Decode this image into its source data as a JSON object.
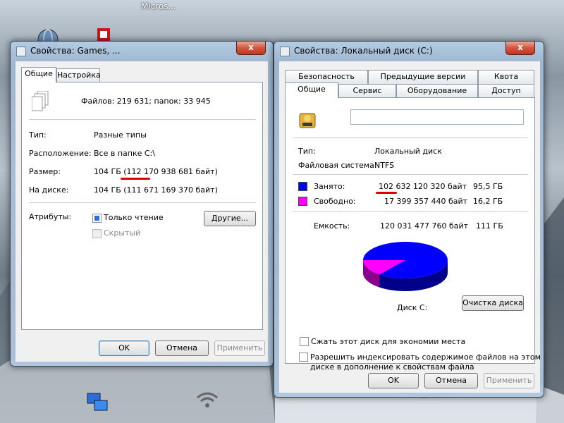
{
  "desktop": {
    "top_label": "Micros..."
  },
  "games_window": {
    "title": "Свойства: Games, ...",
    "close_label": "x",
    "tabs": [
      "Общие",
      "Настройка"
    ],
    "files_summary": "Файлов: 219 631; папок: 33 945",
    "rows": [
      {
        "label": "Тип:",
        "value": "Разные типы"
      },
      {
        "label": "Расположение:",
        "value": "Все в папке C:\\"
      },
      {
        "label": "Размер:",
        "value": "104 ГБ (112 170 938 681 байт)"
      },
      {
        "label": "На диске:",
        "value": "104 ГБ (111 671 169 370 байт)"
      }
    ],
    "attributes_label": "Атрибуты:",
    "readonly_label": "Только чтение",
    "hidden_label": "Скрытый",
    "other_button": "Другие...",
    "ok": "OK",
    "cancel": "Отмена",
    "apply": "Применить"
  },
  "disk_window": {
    "title": "Свойства: Локальный диск (C:)",
    "close_label": "x",
    "tabs_row1": [
      "Безопасность",
      "Предыдущие версии",
      "Квота"
    ],
    "tabs_row2": [
      "Общие",
      "Сервис",
      "Оборудование",
      "Доступ"
    ],
    "type_label": "Тип:",
    "type_value": "Локальный диск",
    "fs_label": "Файловая система:",
    "fs_value": "NTFS",
    "used_label": "Занято:",
    "used_bytes": "102 632 120 320 байт",
    "used_gb": "95,5 ГБ",
    "free_label": "Свободно:",
    "free_bytes": "17 399 357 440 байт",
    "free_gb": "16,2 ГБ",
    "capacity_label": "Емкость:",
    "capacity_bytes": "120 031 477 760 байт",
    "capacity_gb": "111 ГБ",
    "disk_label": "Диск C:",
    "cleanup_button": "Очистка диска",
    "compress_label": "Сжать этот диск для экономии места",
    "index_label_1": "Разрешить индексировать содержимое файлов на этом",
    "index_label_2": "диске в дополнение к свойствам файла",
    "ok": "OK",
    "cancel": "Отмена",
    "apply": "Применить",
    "used_fraction": 0.855,
    "colors": {
      "used": "#0000ff",
      "free": "#ff00ff"
    }
  }
}
